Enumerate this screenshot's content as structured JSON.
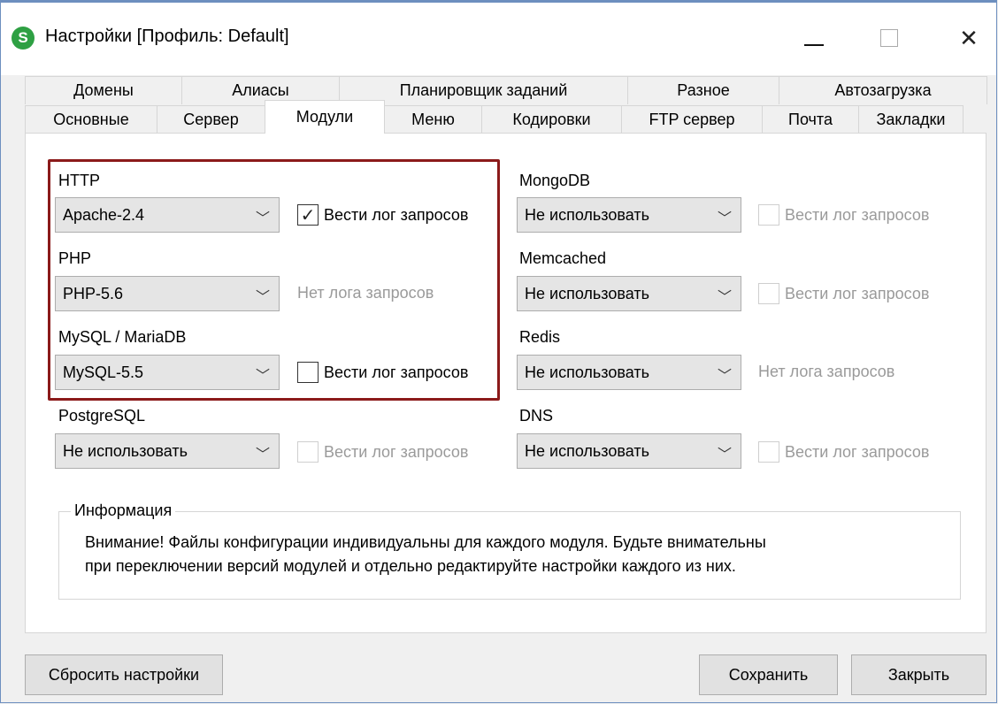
{
  "window": {
    "title": "Настройки [Профиль: Default]",
    "app_icon_letter": "S",
    "close_glyph": "✕"
  },
  "tabs": {
    "back_row": [
      "Домены",
      "Алиасы",
      "Планировщик заданий",
      "Разное",
      "Автозагрузка"
    ],
    "front_row": [
      "Основные",
      "Сервер",
      "Модули",
      "Меню",
      "Кодировки",
      "FTP сервер",
      "Почта",
      "Закладки"
    ],
    "active": "Модули"
  },
  "modules": {
    "http": {
      "label": "HTTP",
      "value": "Apache-2.4",
      "log_label": "Вести лог запросов",
      "log_checked": true
    },
    "php": {
      "label": "PHP",
      "value": "PHP-5.6",
      "log_note": "Нет лога запросов"
    },
    "mysql": {
      "label": "MySQL / MariaDB",
      "value": "MySQL-5.5",
      "log_label": "Вести лог запросов",
      "log_checked": false
    },
    "postgresql": {
      "label": "PostgreSQL",
      "value": "Не использовать",
      "log_label": "Вести лог запросов",
      "log_enabled": false
    },
    "mongodb": {
      "label": "MongoDB",
      "value": "Не использовать",
      "log_label": "Вести лог запросов",
      "log_enabled": false
    },
    "memcached": {
      "label": "Memcached",
      "value": "Не использовать",
      "log_label": "Вести лог запросов",
      "log_enabled": false
    },
    "redis": {
      "label": "Redis",
      "value": "Не использовать",
      "log_note": "Нет лога запросов"
    },
    "dns": {
      "label": "DNS",
      "value": "Не использовать",
      "log_label": "Вести лог запросов",
      "log_enabled": false
    }
  },
  "info": {
    "legend": "Информация",
    "line1": "Внимание! Файлы конфигурации индивидуальны для каждого модуля. Будьте внимательны",
    "line2": "при переключении версий модулей и отдельно редактируйте настройки каждого из них."
  },
  "buttons": {
    "reset": "Сбросить настройки",
    "save": "Сохранить",
    "close": "Закрыть"
  },
  "colors": {
    "highlight": "#8b1a1a",
    "app_icon": "#2ea043"
  },
  "icons": {
    "dropdown": "chevron-down-icon",
    "check": "checkmark-icon"
  }
}
